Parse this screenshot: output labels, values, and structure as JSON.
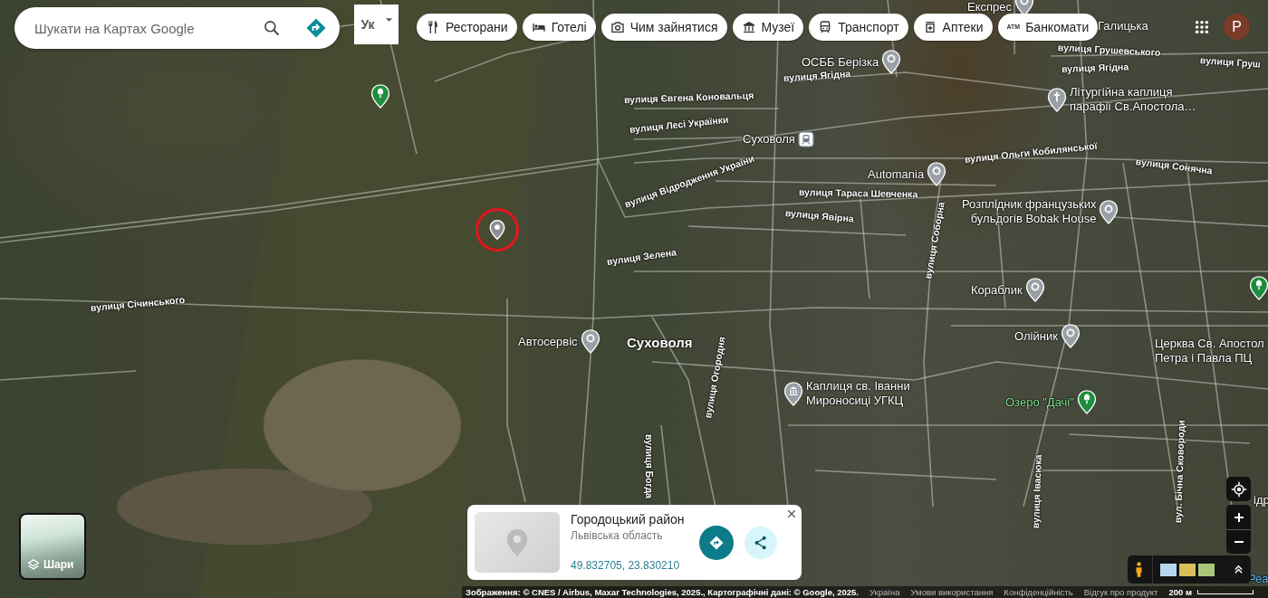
{
  "search": {
    "placeholder": "Шукати на Картах Google"
  },
  "input_tool": {
    "label": "Ук"
  },
  "categories": [
    {
      "label": "Ресторани",
      "kind": "restaurant"
    },
    {
      "label": "Готелі",
      "kind": "hotel"
    },
    {
      "label": "Чим зайнятися",
      "kind": "camera"
    },
    {
      "label": "Музеї",
      "kind": "museum"
    },
    {
      "label": "Транспорт",
      "kind": "transit"
    },
    {
      "label": "Аптеки",
      "kind": "pharmacy"
    },
    {
      "label": "Банкомати",
      "kind": "atm",
      "icon_text": "ATM"
    }
  ],
  "account": {
    "initial": "P"
  },
  "map": {
    "places": [
      {
        "name": "Експрес",
        "kind": "pin",
        "color": "#9aa0a6"
      },
      {
        "name": "Галицька",
        "kind": "label"
      },
      {
        "name": "ОСББ Берізка",
        "kind": "pin",
        "color": "#9aa0a6"
      },
      {
        "kind": "park",
        "color": "#1e8e3e"
      },
      {
        "name": "Літургійна каплиця\nпарафії Св.Апостола…",
        "kind": "church",
        "color": "#9aa0a6"
      },
      {
        "name": "Суховоля",
        "kind": "transit"
      },
      {
        "name": "Automania",
        "kind": "pin",
        "color": "#9aa0a6"
      },
      {
        "name": "Розплідник французьких\nбульдогів Bobak House",
        "kind": "pin",
        "color": "#9aa0a6"
      },
      {
        "name": "Кораблик",
        "kind": "pin",
        "color": "#9aa0a6"
      },
      {
        "kind": "park",
        "color": "#1e8e3e"
      },
      {
        "name": "Автосервіс",
        "kind": "pin",
        "color": "#9aa0a6"
      },
      {
        "name": "Суховоля",
        "kind": "town"
      },
      {
        "name": "Олійник",
        "kind": "pin",
        "color": "#9aa0a6"
      },
      {
        "name": "Церква Св. Апостол\nПетра і Павла ПЦ",
        "kind": "label"
      },
      {
        "name": "Каплиця св. Іванни\nМироносиці УГКЦ",
        "kind": "museum",
        "color": "#9aa0a6"
      },
      {
        "name": "Озеро \"Дачі\"",
        "kind": "park",
        "color": "#1e8e3e"
      },
      {
        "name": "ідр",
        "kind": "label"
      },
      {
        "name": "Реа",
        "kind": "water"
      }
    ],
    "streets": [
      "вулиця Січинського",
      "вулиця Зелена",
      "вулиця Відродження України",
      "вулиця Лесі Українки",
      "вулиця Євгена Коновальця",
      "вулиця Ягідна",
      "вулиця Грушевського",
      "вулиця Ягідна",
      "вулиця Груш",
      "вулиця Ольги Кобилянської",
      "вулиця Тараса Шевченка",
      "вулиця Явірна",
      "вулиця Сонячна",
      "вулиця Соборна",
      "вулиця Огородня",
      "вулиця Богда",
      "вулиця Івасюка",
      "вул. Бічна Сковороди"
    ]
  },
  "place_card": {
    "title": "Городоцький район",
    "subtitle": "Львівська область",
    "coordinates": "49.832705, 23.830210"
  },
  "layers": {
    "label": "Шари"
  },
  "footer": {
    "attribution": "Зображення: © CNES / Airbus, Maxar Technologies, 2025., Картографічні дані: © Google, 2025.",
    "links": [
      "Україна",
      "Умови використання",
      "Конфіденційність",
      "Відгук про продукт"
    ],
    "scale": "200 м"
  }
}
